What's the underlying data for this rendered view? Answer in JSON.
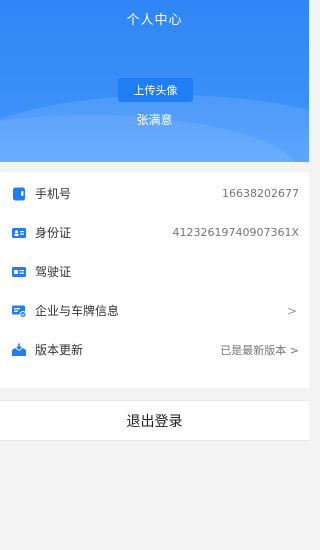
{
  "header": {
    "title": "个人中心",
    "upload_avatar_label": "上传头像",
    "user_name": "张满意",
    "gradient_color": "#3a8ff8"
  },
  "menu": {
    "phone": {
      "label": "手机号",
      "value": "16638202677"
    },
    "id_card": {
      "label": "身份证",
      "value": "41232619740907361X"
    },
    "driver_license": {
      "label": "驾驶证"
    },
    "company_plate": {
      "label": "企业与车牌信息",
      "arrow": ">"
    },
    "version": {
      "label": "版本更新",
      "value": "已是最新版本 >"
    }
  },
  "logout_label": "退出登录",
  "colors": {
    "icon_blue": "#1f7ef4",
    "text": "#333333",
    "muted": "#777777"
  },
  "icons": [
    "phone-icon",
    "id-card-icon",
    "driver-license-icon",
    "company-plate-icon",
    "version-update-icon"
  ]
}
